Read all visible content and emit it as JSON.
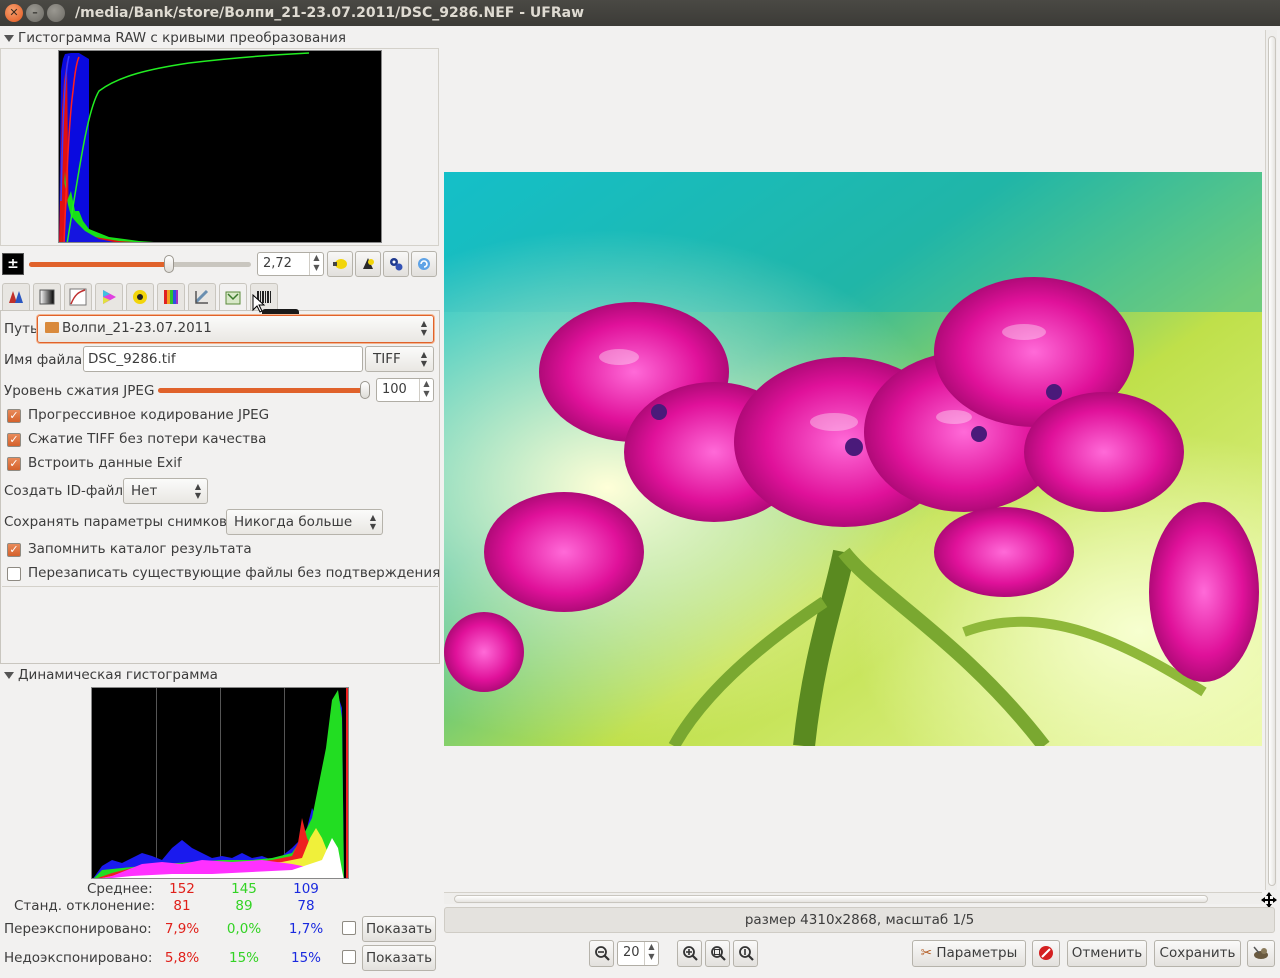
{
  "window": {
    "title": "/media/Bank/store/Волпи_21-23.07.2011/DSC_9286.NEF - UFRaw"
  },
  "raw_histogram": {
    "label": "Гистограмма RAW с кривыми преобразования"
  },
  "exposure": {
    "value": "2,72",
    "slider_fraction": 0.63
  },
  "tabs": [
    {
      "name": "white-balance",
      "icon": "wb-icon"
    },
    {
      "name": "grayscale",
      "icon": "grayscale-icon"
    },
    {
      "name": "base-curve",
      "icon": "curve-icon"
    },
    {
      "name": "color-management",
      "icon": "color-icon"
    },
    {
      "name": "corrections",
      "icon": "lightness-icon"
    },
    {
      "name": "lightness",
      "icon": "spectrum-icon"
    },
    {
      "name": "crop-rotate",
      "icon": "crop-icon"
    },
    {
      "name": "save",
      "icon": "save-icon"
    },
    {
      "name": "exif",
      "icon": "exif-icon"
    }
  ],
  "tooltip": "EXIF",
  "save_tab": {
    "path_label": "Путь",
    "path_value": "Волпи_21-23.07.2011",
    "filename_label": "Имя файла",
    "filename_value": "DSC_9286.tif",
    "format_value": "TIFF",
    "jpeg_label": "Уровень сжатия JPEG",
    "jpeg_value": "100",
    "jpeg_fraction": 1.0,
    "progressive_label": "Прогрессивное кодирование JPEG",
    "progressive_checked": true,
    "tiff_label": "Сжатие TIFF без потери качества",
    "tiff_checked": true,
    "exif_label": "Встроить данные Exif",
    "exif_checked": true,
    "idfile_label": "Создать ID-файл",
    "idfile_value": "Нет",
    "saveparams_label": "Сохранять параметры снимков",
    "saveparams_value": "Никогда больше",
    "remember_label": "Запомнить каталог результата",
    "remember_checked": true,
    "overwrite_label": "Перезаписать существующие файлы без подтверждения",
    "overwrite_checked": false
  },
  "live_histogram": {
    "label": "Динамическая гистограмма",
    "avg_label": "Среднее:",
    "avg": [
      "152",
      "145",
      "109"
    ],
    "std_label": "Станд. отклонение:",
    "std": [
      "81",
      "89",
      "78"
    ],
    "over_label": "Переэкспонировано:",
    "over": [
      "7,9%",
      "0,0%",
      "1,7%"
    ],
    "under_label": "Недоэкспонировано:",
    "under": [
      "5,8%",
      "15%",
      "15%"
    ],
    "show_label": "Показать"
  },
  "status": "размер 4310x2868, масштаб 1/5",
  "zoom": {
    "value": "20"
  },
  "buttons": {
    "options": "Параметры",
    "cancel": "Отменить",
    "save": "Сохранить"
  },
  "colors": {
    "accent": "#e0622b",
    "red": "#e0201a",
    "green": "#33d324",
    "blue": "#1a2adf"
  }
}
